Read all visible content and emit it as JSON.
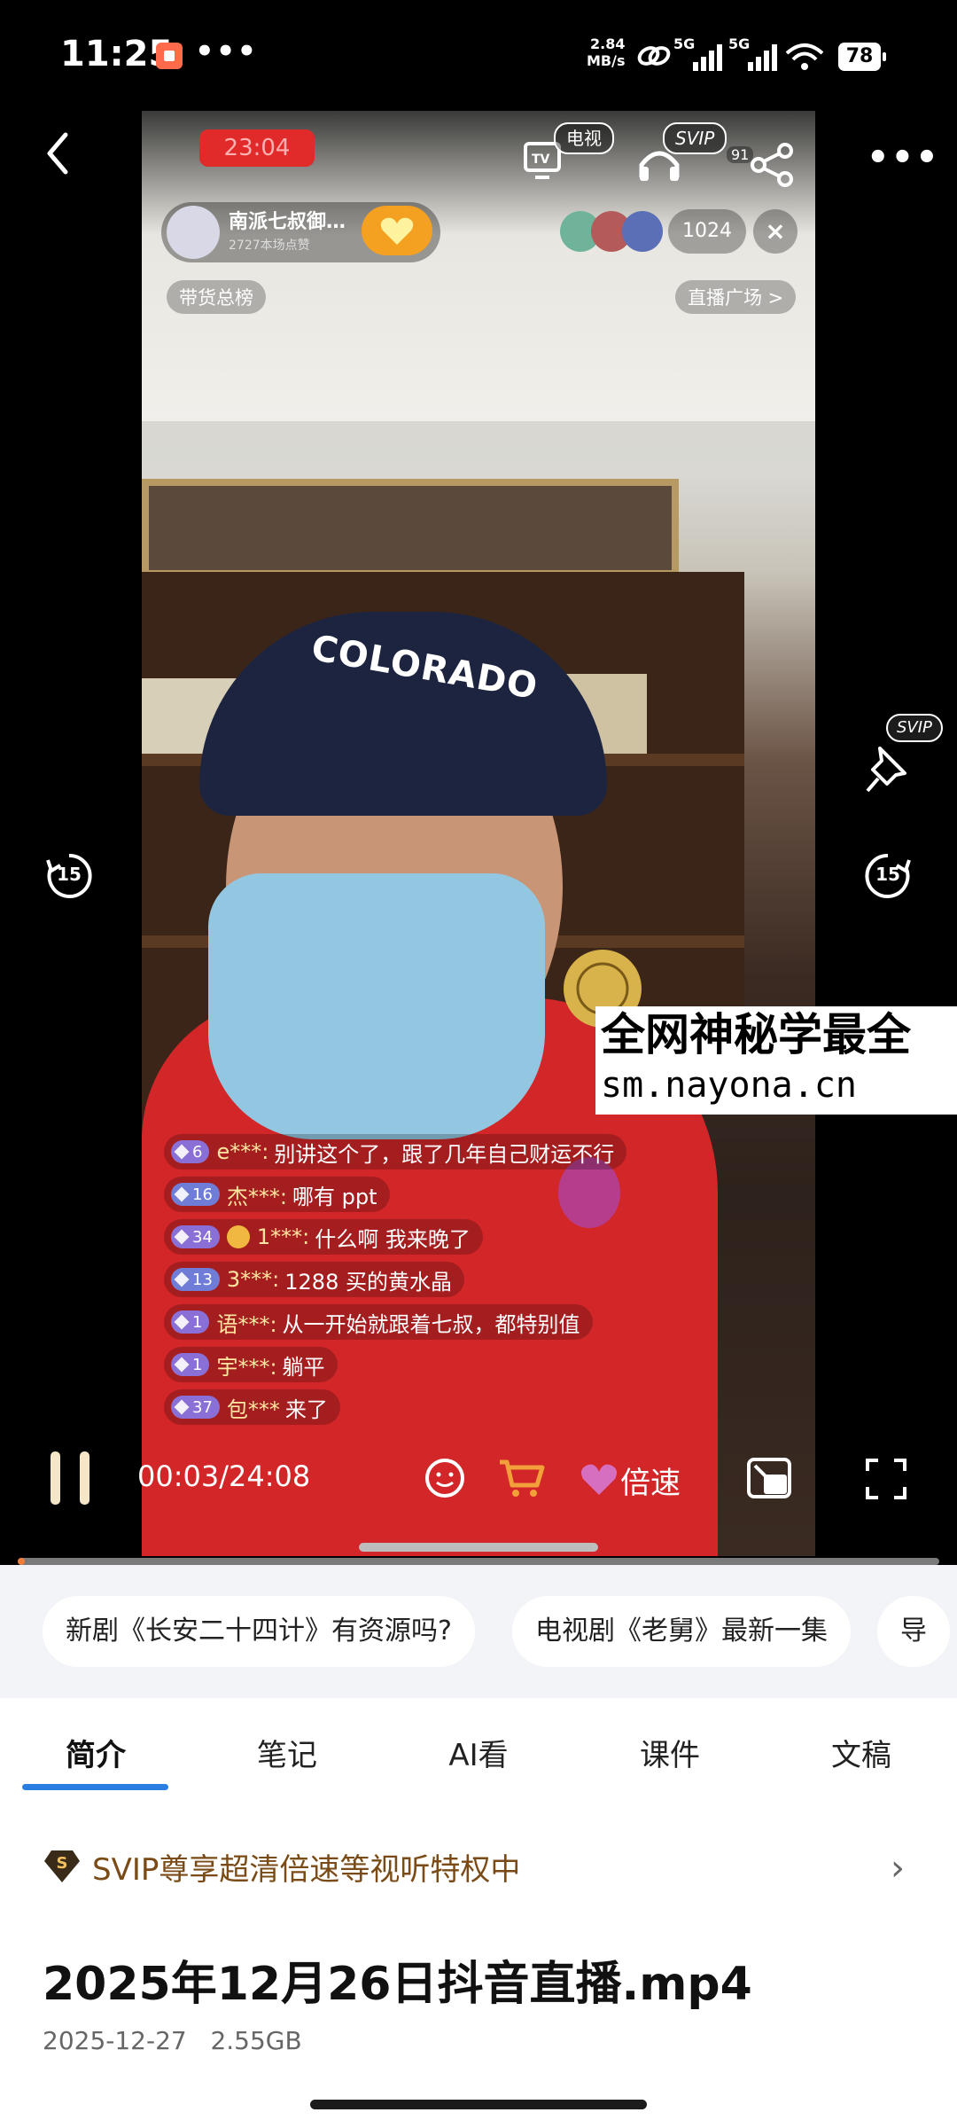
{
  "status_bar": {
    "time": "11:25",
    "net_speed_value": "2.84",
    "net_speed_unit": "MB/s",
    "signal1_label": "5G",
    "signal2_label": "5G",
    "battery": "78"
  },
  "live_video": {
    "record_time": "23:04",
    "host": {
      "name": "南派七叔御…",
      "likes": "2727本场点赞"
    },
    "viewer_count": "1024",
    "close_symbol": "×",
    "tv_badge": "电视",
    "svip_badge": "SVIP",
    "share_count": "91",
    "sales_rank_label": "带货总榜",
    "live_plaza_label": "直播广场 >",
    "cap_text": "COLORADO",
    "chat": [
      {
        "level": "6",
        "user": "e***:",
        "message": "别讲这个了，跟了几年自己财运不行"
      },
      {
        "level": "16",
        "user": "杰***:",
        "message": "哪有 ppt"
      },
      {
        "level": "34",
        "user": "1***:",
        "message": "什么啊 我来晚了"
      },
      {
        "level": "13",
        "user": "3***:",
        "message": "1288 买的黄水晶"
      },
      {
        "level": "1",
        "user": "语***:",
        "message": "从一开始就跟着七叔，都特别值"
      },
      {
        "level": "1",
        "user": "宇***:",
        "message": "躺平"
      },
      {
        "level": "37",
        "user": "包***",
        "message": "来了"
      }
    ]
  },
  "watermark": {
    "line1": "全网神秘学最全",
    "line2": "sm.nayona.cn"
  },
  "player": {
    "current_time": "00:03",
    "duration": "24:08",
    "time_display": "00:03/24:08",
    "skip_seconds": "15",
    "speed_label": "倍速",
    "svip_pin_badge": "SVIP",
    "progress_fraction": 0.002
  },
  "suggestions": [
    "新剧《长安二十四计》有资源吗?",
    "电视剧《老舅》最新一集",
    "导"
  ],
  "tabs": [
    {
      "label": "简介",
      "active": true
    },
    {
      "label": "笔记",
      "active": false
    },
    {
      "label": "AI看",
      "active": false
    },
    {
      "label": "课件",
      "active": false
    },
    {
      "label": "文稿",
      "active": false
    }
  ],
  "svip_promo": {
    "icon_letter": "S",
    "text": "SVIP尊享超清倍速等视听特权中"
  },
  "file": {
    "title": "2025年12月26日抖音直播.mp4",
    "date": "2025-12-27",
    "size": "2.55GB"
  },
  "colors": {
    "accent": "#2a7de1",
    "progress": "#f07e3a",
    "svip_text": "#7a4b16",
    "rec_red": "#e12a2a"
  }
}
